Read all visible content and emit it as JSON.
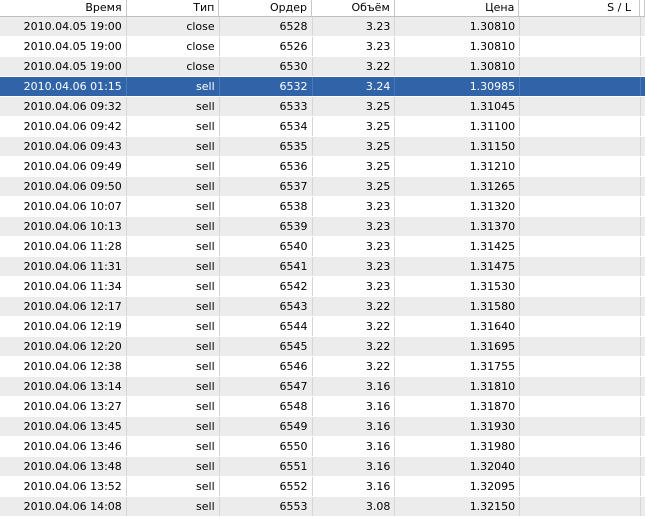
{
  "columns": {
    "time": "Время",
    "type": "Тип",
    "order": "Ордер",
    "volume": "Объём",
    "price": "Цена",
    "sl": "S / L"
  },
  "selected_index": 3,
  "rows": [
    {
      "time": "2010.04.05 19:00",
      "type": "close",
      "order": "6528",
      "volume": "3.23",
      "price": "1.30810",
      "sl": ""
    },
    {
      "time": "2010.04.05 19:00",
      "type": "close",
      "order": "6526",
      "volume": "3.23",
      "price": "1.30810",
      "sl": ""
    },
    {
      "time": "2010.04.05 19:00",
      "type": "close",
      "order": "6530",
      "volume": "3.22",
      "price": "1.30810",
      "sl": ""
    },
    {
      "time": "2010.04.06 01:15",
      "type": "sell",
      "order": "6532",
      "volume": "3.24",
      "price": "1.30985",
      "sl": ""
    },
    {
      "time": "2010.04.06 09:32",
      "type": "sell",
      "order": "6533",
      "volume": "3.25",
      "price": "1.31045",
      "sl": ""
    },
    {
      "time": "2010.04.06 09:42",
      "type": "sell",
      "order": "6534",
      "volume": "3.25",
      "price": "1.31100",
      "sl": ""
    },
    {
      "time": "2010.04.06 09:43",
      "type": "sell",
      "order": "6535",
      "volume": "3.25",
      "price": "1.31150",
      "sl": ""
    },
    {
      "time": "2010.04.06 09:49",
      "type": "sell",
      "order": "6536",
      "volume": "3.25",
      "price": "1.31210",
      "sl": ""
    },
    {
      "time": "2010.04.06 09:50",
      "type": "sell",
      "order": "6537",
      "volume": "3.25",
      "price": "1.31265",
      "sl": ""
    },
    {
      "time": "2010.04.06 10:07",
      "type": "sell",
      "order": "6538",
      "volume": "3.23",
      "price": "1.31320",
      "sl": ""
    },
    {
      "time": "2010.04.06 10:13",
      "type": "sell",
      "order": "6539",
      "volume": "3.23",
      "price": "1.31370",
      "sl": ""
    },
    {
      "time": "2010.04.06 11:28",
      "type": "sell",
      "order": "6540",
      "volume": "3.23",
      "price": "1.31425",
      "sl": ""
    },
    {
      "time": "2010.04.06 11:31",
      "type": "sell",
      "order": "6541",
      "volume": "3.23",
      "price": "1.31475",
      "sl": ""
    },
    {
      "time": "2010.04.06 11:34",
      "type": "sell",
      "order": "6542",
      "volume": "3.23",
      "price": "1.31530",
      "sl": ""
    },
    {
      "time": "2010.04.06 12:17",
      "type": "sell",
      "order": "6543",
      "volume": "3.22",
      "price": "1.31580",
      "sl": ""
    },
    {
      "time": "2010.04.06 12:19",
      "type": "sell",
      "order": "6544",
      "volume": "3.22",
      "price": "1.31640",
      "sl": ""
    },
    {
      "time": "2010.04.06 12:20",
      "type": "sell",
      "order": "6545",
      "volume": "3.22",
      "price": "1.31695",
      "sl": ""
    },
    {
      "time": "2010.04.06 12:38",
      "type": "sell",
      "order": "6546",
      "volume": "3.22",
      "price": "1.31755",
      "sl": ""
    },
    {
      "time": "2010.04.06 13:14",
      "type": "sell",
      "order": "6547",
      "volume": "3.16",
      "price": "1.31810",
      "sl": ""
    },
    {
      "time": "2010.04.06 13:27",
      "type": "sell",
      "order": "6548",
      "volume": "3.16",
      "price": "1.31870",
      "sl": ""
    },
    {
      "time": "2010.04.06 13:45",
      "type": "sell",
      "order": "6549",
      "volume": "3.16",
      "price": "1.31930",
      "sl": ""
    },
    {
      "time": "2010.04.06 13:46",
      "type": "sell",
      "order": "6550",
      "volume": "3.16",
      "price": "1.31980",
      "sl": ""
    },
    {
      "time": "2010.04.06 13:48",
      "type": "sell",
      "order": "6551",
      "volume": "3.16",
      "price": "1.32040",
      "sl": ""
    },
    {
      "time": "2010.04.06 13:52",
      "type": "sell",
      "order": "6552",
      "volume": "3.16",
      "price": "1.32095",
      "sl": ""
    },
    {
      "time": "2010.04.06 14:08",
      "type": "sell",
      "order": "6553",
      "volume": "3.08",
      "price": "1.32150",
      "sl": ""
    }
  ],
  "colors": {
    "selected_bg": "#3163a8",
    "stripe_bg": "#ececec",
    "row_bg": "#ffffff"
  }
}
